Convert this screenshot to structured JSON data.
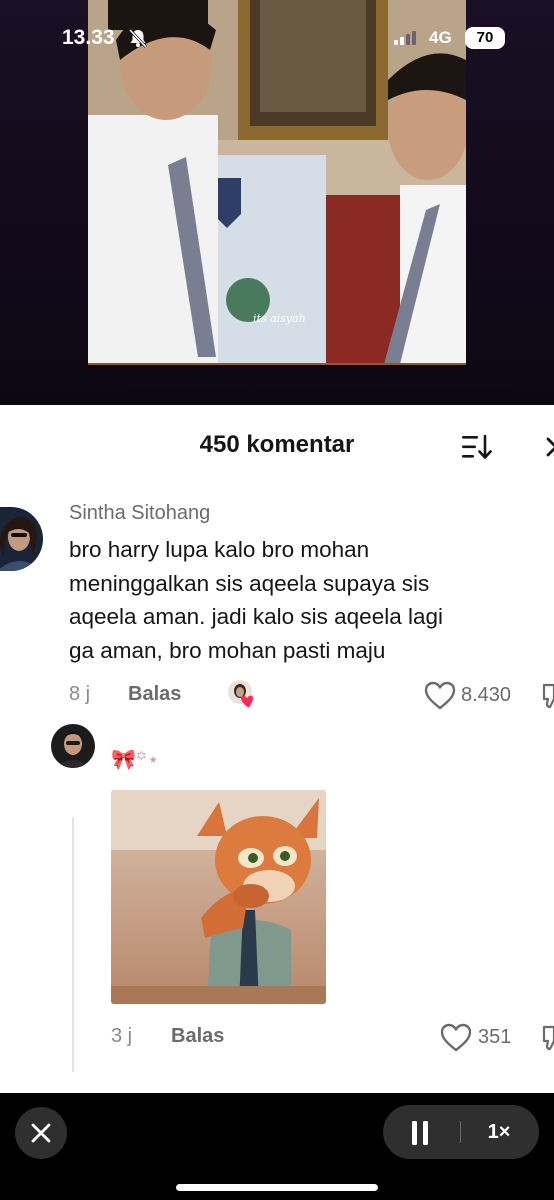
{
  "status_bar": {
    "time": "13.33",
    "network": "4G",
    "battery": "70"
  },
  "video": {
    "watermark": "its aisyah"
  },
  "comments_sheet": {
    "title": "450 komentar",
    "comments": [
      {
        "username": "Sintha Sitohang",
        "text_lines": [
          "bro harry lupa kalo bro mohan",
          "meninggalkan sis aqeela supaya sis",
          "aqeela aman. jadi kalo sis aqeela lagi",
          "ga aman, bro mohan pasti maju"
        ],
        "time": "8 j",
        "reply_label": "Balas",
        "likes": "8.430"
      },
      {
        "username": "🎀꙳⋆",
        "time": "3 j",
        "reply_label": "Balas",
        "likes": "351"
      }
    ]
  },
  "player_controls": {
    "speed": "1×"
  },
  "colors": {
    "sheet_bg": "#ffffff",
    "liked_heart": "#fe2c55",
    "text_primary": "#161616",
    "text_secondary": "#6b6b6b"
  }
}
